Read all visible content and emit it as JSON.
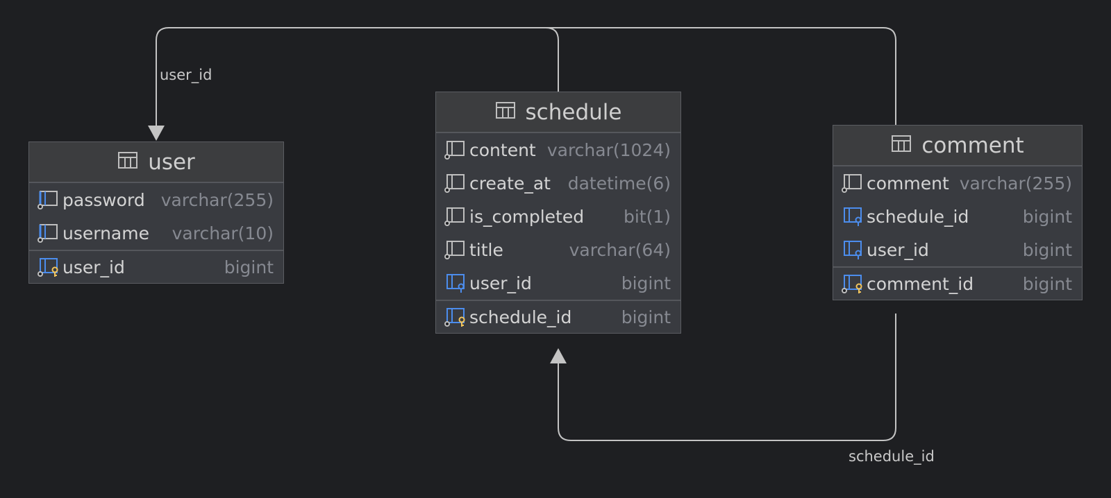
{
  "colors": {
    "background": "#1e1f22",
    "line": "#c4c4c4",
    "fk_blue": "#4c8ded",
    "pk_gold": "#f2c55c"
  },
  "connections": {
    "user_label": "user_id",
    "schedule_label": "schedule_id"
  },
  "tables": {
    "user": {
      "name": "user",
      "columns": [
        {
          "name": "password",
          "type": "varchar(255)",
          "icon": "column-index-icon"
        },
        {
          "name": "username",
          "type": "varchar(10)",
          "icon": "column-index-icon"
        },
        {
          "name": "user_id",
          "type": "bigint",
          "icon": "primary-key-icon"
        }
      ]
    },
    "schedule": {
      "name": "schedule",
      "columns": [
        {
          "name": "content",
          "type": "varchar(1024)",
          "icon": "column-icon"
        },
        {
          "name": "create_at",
          "type": "datetime(6)",
          "icon": "column-icon"
        },
        {
          "name": "is_completed",
          "type": "bit(1)",
          "icon": "column-icon"
        },
        {
          "name": "title",
          "type": "varchar(64)",
          "icon": "column-icon"
        },
        {
          "name": "user_id",
          "type": "bigint",
          "icon": "foreign-key-icon"
        },
        {
          "name": "schedule_id",
          "type": "bigint",
          "icon": "primary-key-icon"
        }
      ]
    },
    "comment": {
      "name": "comment",
      "columns": [
        {
          "name": "comment",
          "type": "varchar(255)",
          "icon": "column-icon"
        },
        {
          "name": "schedule_id",
          "type": "bigint",
          "icon": "foreign-key-icon"
        },
        {
          "name": "user_id",
          "type": "bigint",
          "icon": "foreign-key-icon"
        },
        {
          "name": "comment_id",
          "type": "bigint",
          "icon": "primary-key-icon"
        }
      ]
    }
  }
}
